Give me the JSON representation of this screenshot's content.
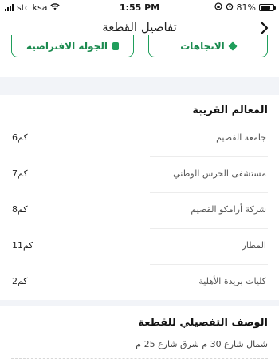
{
  "status_bar": {
    "carrier": "stc ksa",
    "time": "1:55 PM",
    "battery": "81%",
    "battery_level": 0.81
  },
  "header": {
    "title": "تفاصيل القطعة",
    "back_icon": "chevron-right-icon"
  },
  "actions": {
    "directions_label": "الاتجاهات",
    "tour_label": "الجولة الافتراضية",
    "accent_color": "#1f9e5b"
  },
  "landmarks": {
    "title": "المعالم القريبة",
    "items": [
      {
        "name": "جامعة القصيم",
        "distance": "6كم"
      },
      {
        "name": "مستشفى الحرس الوطني",
        "distance": "7كم"
      },
      {
        "name": "شركة أرامكو القصيم",
        "distance": "8كم"
      },
      {
        "name": "المطار",
        "distance": "11كم"
      },
      {
        "name": "كليات بريدة الأهلية",
        "distance": "2كم"
      }
    ]
  },
  "description": {
    "title": "الوصف التفصيلي للقطعة",
    "text": "شمال شارع 30 م شرق شارع 25 م"
  }
}
